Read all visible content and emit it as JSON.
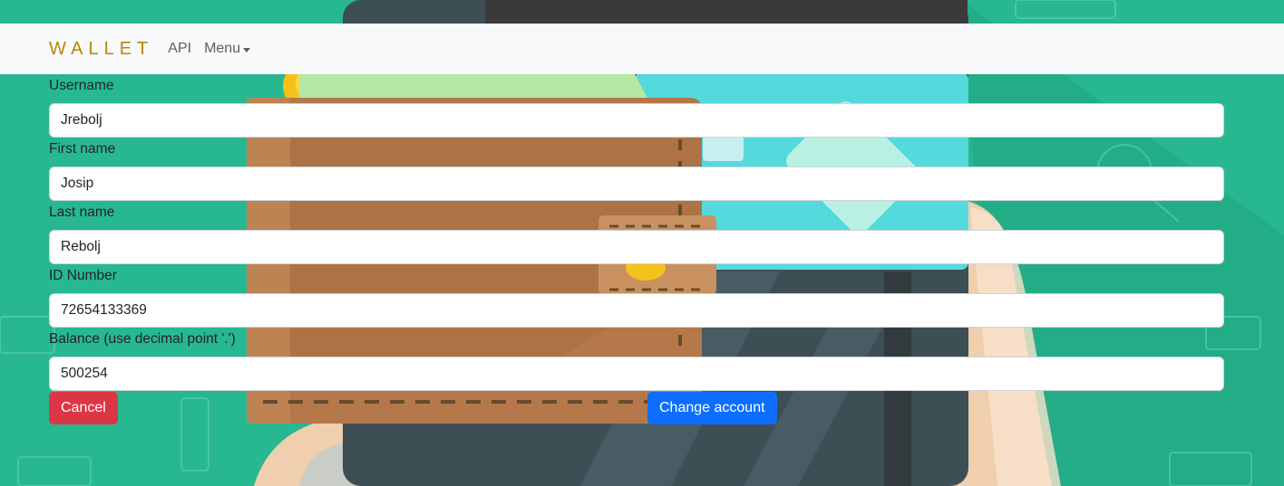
{
  "navbar": {
    "brand": "WALLET",
    "links": [
      {
        "label": "API"
      },
      {
        "label": "Menu"
      }
    ]
  },
  "form": {
    "fields": [
      {
        "label": "Username",
        "value": "Jrebolj"
      },
      {
        "label": "First name",
        "value": "Josip"
      },
      {
        "label": "Last name",
        "value": "Rebolj"
      },
      {
        "label": "ID Number",
        "value": "72654133369"
      },
      {
        "label": "Balance (use decimal point '.')",
        "value": "500254"
      }
    ],
    "cancel_label": "Cancel",
    "submit_label": "Change account"
  },
  "colors": {
    "background": "#27b891",
    "brand": "#b8860b",
    "cancel": "#dc3545",
    "submit": "#0d6efd"
  }
}
